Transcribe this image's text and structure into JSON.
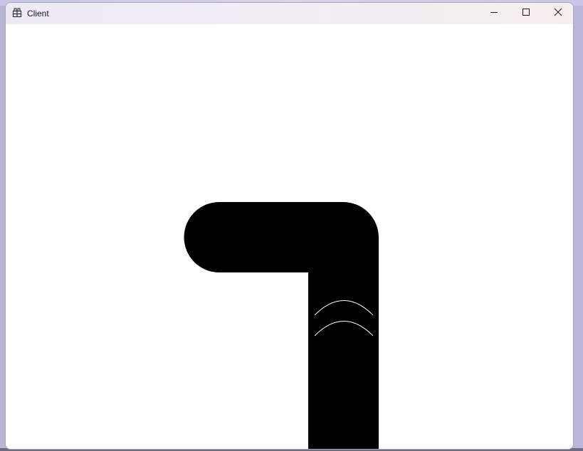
{
  "window": {
    "title": "Client",
    "icon": "app-grid-icon"
  },
  "controls": {
    "minimize_icon": "minimize-icon",
    "maximize_icon": "maximize-icon",
    "close_icon": "close-icon"
  },
  "colors": {
    "shape_fill": "#000000",
    "arc_stroke": "#ffffff",
    "background": "#ffffff"
  }
}
